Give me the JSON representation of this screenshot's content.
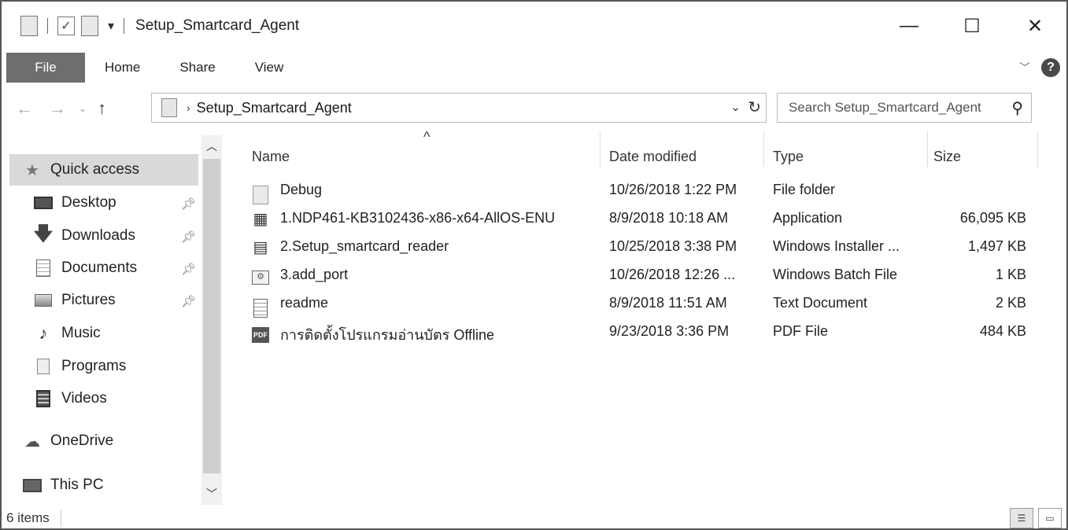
{
  "window": {
    "title": "Setup_Smartcard_Agent",
    "qat_dropdown": "▾",
    "controls": {
      "minimize": "—",
      "maximize": "☐",
      "close": "✕"
    }
  },
  "ribbon": {
    "tabs": [
      "File",
      "Home",
      "Share",
      "View"
    ],
    "expand_icon": "chevron-down-icon",
    "help_icon": "help-icon"
  },
  "navigation": {
    "back": "←",
    "forward": "→",
    "recent": "⌄",
    "up": "↑",
    "address_separator": "›",
    "address_path": "Setup_Smartcard_Agent",
    "address_dropdown": "⌄",
    "refresh": "↻",
    "search_placeholder": "Search Setup_Smartcard_Agent"
  },
  "nav_pane": {
    "quick_access": "Quick access",
    "items": [
      {
        "label": "Desktop",
        "pinned": true,
        "icon": "desktop-icon"
      },
      {
        "label": "Downloads",
        "pinned": true,
        "icon": "download-icon"
      },
      {
        "label": "Documents",
        "pinned": true,
        "icon": "documents-icon"
      },
      {
        "label": "Pictures",
        "pinned": true,
        "icon": "pictures-icon"
      },
      {
        "label": "Music",
        "pinned": false,
        "icon": "music-icon"
      },
      {
        "label": "Programs",
        "pinned": false,
        "icon": "programs-icon"
      },
      {
        "label": "Videos",
        "pinned": false,
        "icon": "videos-icon"
      }
    ],
    "onedrive": "OneDrive",
    "this_pc": "This PC",
    "pin_glyph": "📌"
  },
  "file_list": {
    "sort_indicator": "^",
    "columns": [
      "Name",
      "Date modified",
      "Type",
      "Size"
    ],
    "rows": [
      {
        "name": "Debug",
        "date": "10/26/2018 1:22 PM",
        "type": "File folder",
        "size": "",
        "icon": "folder-icon"
      },
      {
        "name": "1.NDP461-KB3102436-x86-x64-AllOS-ENU",
        "date": "8/9/2018 10:18 AM",
        "type": "Application",
        "size": "66,095 KB",
        "icon": "application-icon"
      },
      {
        "name": "2.Setup_smartcard_reader",
        "date": "10/25/2018 3:38 PM",
        "type": "Windows Installer ...",
        "size": "1,497 KB",
        "icon": "installer-icon"
      },
      {
        "name": "3.add_port",
        "date": "10/26/2018 12:26 ...",
        "type": "Windows Batch File",
        "size": "1 KB",
        "icon": "batch-file-icon"
      },
      {
        "name": "readme",
        "date": "8/9/2018 11:51 AM",
        "type": "Text Document",
        "size": "2 KB",
        "icon": "text-document-icon"
      },
      {
        "name": "การติดตั้งโปรแกรมอ่านบัตร Offline",
        "date": "9/23/2018 3:36 PM",
        "type": "PDF File",
        "size": "484 KB",
        "icon": "pdf-icon"
      }
    ]
  },
  "status": {
    "item_count": "6 items"
  }
}
